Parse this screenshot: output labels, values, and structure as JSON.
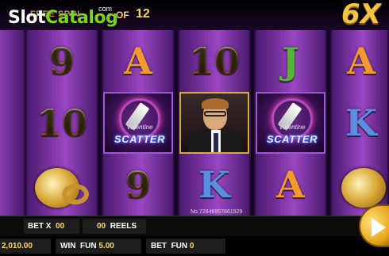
{
  "header": {
    "logo_white": "Slot",
    "logo_green": "Catalog",
    "logo_com": "com",
    "free_spin_label": "FREE SPIN",
    "of_label": "OF",
    "free_spin_total": "12",
    "multiplier": "6X"
  },
  "reels": {
    "col1": [
      "9",
      "10",
      "ring"
    ],
    "col2": [
      "A",
      "SCATTER",
      "9"
    ],
    "col3": [
      "10",
      "portrait",
      "K"
    ],
    "col4": [
      "J",
      "SCATTER",
      "A"
    ],
    "col5": [
      "A",
      "K",
      "ring"
    ]
  },
  "symbols": {
    "scatter_sub": "Valentine",
    "scatter_label": "SCATTER",
    "serial": "No.72846957661929"
  },
  "bottom": {
    "bet_x_label": "BET X",
    "bet_x_value": "00",
    "reels_value": "00",
    "reels_label": "REELS",
    "balance_value": "2,010.00",
    "win_label": "WIN",
    "win_fun_label": "FUN",
    "win_value": "5.00",
    "bet_label": "BET",
    "bet_fun_label": "FUN",
    "bet_value": "0"
  },
  "colors": {
    "reel_purple": "#8b3cb3",
    "gold": "#f5c342",
    "logo_green": "#7ed321"
  }
}
